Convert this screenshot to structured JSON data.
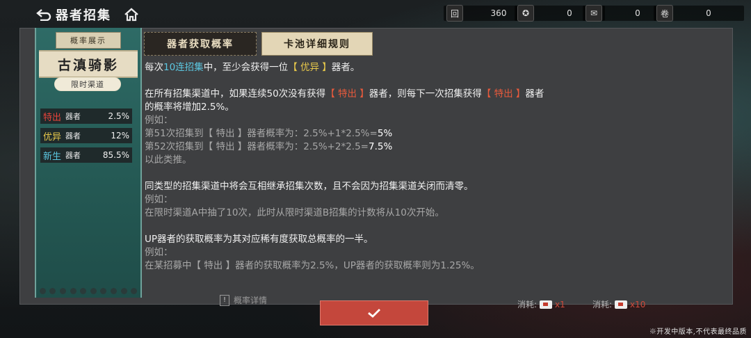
{
  "header": {
    "title": "器者招集",
    "back_icon": "back-arrow-icon",
    "home_icon": "home-icon",
    "currencies": [
      {
        "icon": "jade-token-icon",
        "glyph": "回",
        "value": "360"
      },
      {
        "icon": "coin-icon",
        "glyph": "✪",
        "value": "0"
      },
      {
        "icon": "ticket-icon",
        "glyph": "✉",
        "value": "0"
      },
      {
        "icon": "scroll-icon",
        "glyph": "卷",
        "value": "0"
      }
    ]
  },
  "sidebar": {
    "ribbon": "概率展示",
    "pool_name": "古滇骑影",
    "channel": "限时渠道",
    "rates": [
      {
        "tier": "特出",
        "tier_color": "#e8433a",
        "unit": "器者",
        "value": "2.5%"
      },
      {
        "tier": "优异",
        "tier_color": "#e8c94b",
        "unit": "器者",
        "value": "12%"
      },
      {
        "tier": "新生",
        "tier_color": "#5cc8e2",
        "unit": "器者",
        "value": "85.5%"
      }
    ]
  },
  "tabs": [
    {
      "label": "器者获取概率",
      "active": false
    },
    {
      "label": "卡池详细规则",
      "active": true
    }
  ],
  "rules": {
    "p1": {
      "a": "每次",
      "b": "10连招集",
      "c": "中，至少会获得一位",
      "d": "【 优异 】",
      "e": "器者。"
    },
    "p2": {
      "l1a": "在所有招集渠道中，如果连续50次没有获得",
      "l1b": "【 特出 】",
      "l1c": "器者，则每下一次招集获得",
      "l1d": "【 特出 】",
      "l1e": "器者",
      "l2": "的概率将增加2.5%。",
      "l3": "例如：",
      "l4a": "第51次招集到【 特出 】器者概率为：2.5%+1*2.5%=",
      "l4b": "5%",
      "l5a": "第52次招集到【 特出 】器者概率为：2.5%+2*2.5=",
      "l5b": "7.5%",
      "l6": "以此类推。"
    },
    "p3": {
      "l1": "同类型的招集渠道中将会互相继承招集次数，且不会因为招集渠道关闭而清零。",
      "l2": "例如：",
      "l3": "在限时渠道A中抽了10次，此时从限时渠道B招集的计数将从10次开始。"
    },
    "p4": {
      "l1": "UP器者的获取概率为其对应稀有度获取总概率的一半。",
      "l2": "例如：",
      "l3": "在某招募中【 特出 】器者的获取概率为2.5%，UP器者的获取概率则为1.25%。"
    }
  },
  "footer": {
    "rate_detail": "概率详情",
    "confirm_icon": "checkmark-icon",
    "cost1_label": "消耗:",
    "cost1_count": "x1",
    "cost10_label": "消耗:",
    "cost10_count": "x10",
    "disclaimer": "※开发中版本,不代表最终品质"
  },
  "colors": {
    "accent_red": "#e85a3c",
    "cyan": "#5cc8e2",
    "yellow": "#e8c94b",
    "sidebar_teal": "#2e6b66",
    "confirm_red": "#c4473c"
  }
}
